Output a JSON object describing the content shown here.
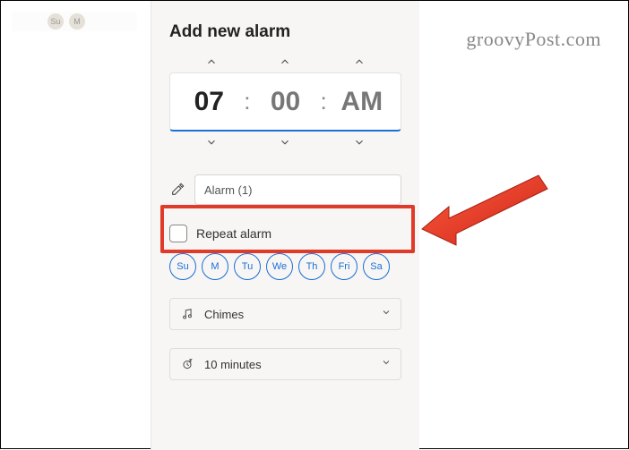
{
  "watermark": "groovyPost.com",
  "tab_avatars": [
    "Su",
    "M"
  ],
  "panel": {
    "title": "Add new alarm",
    "time": {
      "hour": "07",
      "minute": "00",
      "ampm": "AM"
    },
    "name_field": {
      "value": "Alarm (1)"
    },
    "repeat": {
      "label": "Repeat alarm",
      "checked": false
    },
    "days": [
      "Su",
      "M",
      "Tu",
      "We",
      "Th",
      "Fri",
      "Sa"
    ],
    "sound": {
      "label": "Chimes"
    },
    "snooze": {
      "label": "10 minutes"
    }
  }
}
